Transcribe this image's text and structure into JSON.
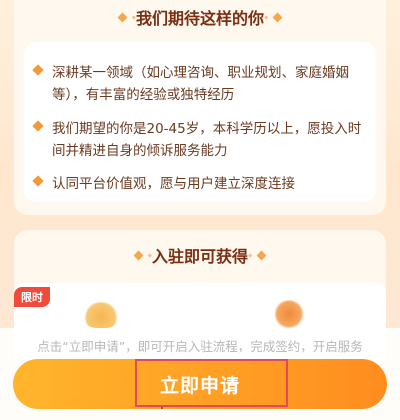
{
  "requirements": {
    "title": "我们期待这样的你",
    "items": [
      {
        "text": "深耕某一领域（如心理咨询、职业规划、家庭婚姻等），有丰富的经验或独特经历"
      },
      {
        "text": "我们期望的你是20-45岁，本科学历以上，愿投入时间并精进自身的倾诉服务能力"
      },
      {
        "text": "认同平台价值观，愿与用户建立深度连接"
      }
    ]
  },
  "benefits": {
    "title": "入驻即可获得",
    "badge": "限时"
  },
  "footer": {
    "hint": "点击“立即申请”，即可开启入驻流程，完成签约，开启服务",
    "apply_label": "立即申请"
  },
  "colors": {
    "accent": "#ff9a23",
    "title": "#7a2e12",
    "badge": "#f04a3b"
  }
}
